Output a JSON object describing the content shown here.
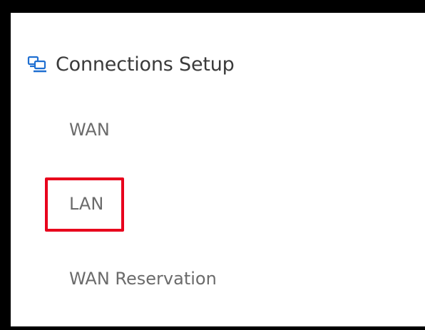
{
  "section": {
    "title": "Connections Setup",
    "icon": "connections-icon"
  },
  "nav": {
    "items": [
      {
        "label": "WAN"
      },
      {
        "label": "LAN",
        "highlighted": true
      },
      {
        "label": "WAN Reservation"
      }
    ]
  },
  "colors": {
    "accent": "#1f6fd1",
    "highlight": "#e8001c",
    "text": "#3a3a3a",
    "muted_text": "#6b6b6b"
  }
}
